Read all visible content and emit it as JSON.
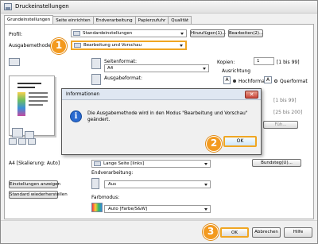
{
  "window": {
    "title": "Druckeinstellungen"
  },
  "tabs": [
    "Grundeinstellungen",
    "Seite einrichten",
    "Endverarbeitung",
    "Papierzufuhr",
    "Qualität"
  ],
  "profile": {
    "label": "Profil:",
    "value": "Standardeinstellungen",
    "add_button": "Hinzufügen(1)...",
    "edit_button": "Bearbeiten(2)..."
  },
  "output": {
    "label": "Ausgabemethode:",
    "value": "Bearbeitung und Vorschau"
  },
  "page_format": {
    "label": "Seitenformat:",
    "value": "A4"
  },
  "output_format": {
    "label": "Ausgabeformat:"
  },
  "copies": {
    "label": "Kopien:",
    "value": "1",
    "range": "[1 bis 99]"
  },
  "orientation": {
    "label": "Ausrichtung",
    "portrait": "Hochformat",
    "landscape": "Querformat",
    "portrait_letter": "A",
    "landscape_letter": "A"
  },
  "side_range": "[1 bis 99]",
  "right_range_2": "[25 bis 200]",
  "right_button_2": "Füh...",
  "binding": {
    "value": "Lange Seite [links]",
    "button": "Bundsteg(U)..."
  },
  "preview_caption": "A4 [Skalierung: Auto]",
  "finishing": {
    "label": "Endverarbeitung:",
    "value": "Aus"
  },
  "left_buttons": {
    "show_settings": "Einstellungen anzeigen",
    "restore_defaults": "Standard wiederherstellen"
  },
  "color_mode": {
    "label": "Farbmodus:",
    "value": "Auto [Farbe/S&W]"
  },
  "dialog": {
    "title": "Informationen",
    "close_glyph": "✕",
    "info_glyph": "i",
    "message": "Die Ausgabemethode wird in den Modus \"Bearbeitung und Vorschau\" geändert.",
    "ok_button": "OK"
  },
  "footer": {
    "ok": "OK",
    "cancel": "Abbrechen",
    "help": "Hilfe"
  },
  "markers": [
    "1",
    "2",
    "3"
  ],
  "colors": {
    "accent": "#f39a1f",
    "highlight_border": "#f0a623",
    "info_blue": "#2a6ad0"
  }
}
